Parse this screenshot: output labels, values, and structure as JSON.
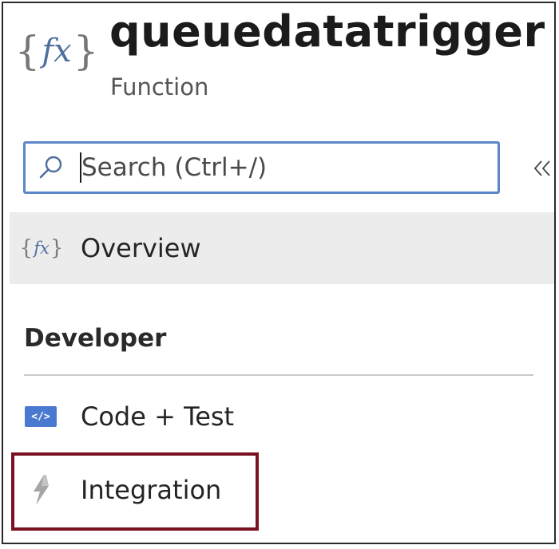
{
  "header": {
    "icon": "function-fx-icon",
    "title": "queuedatatrigger",
    "subtitle": "Function"
  },
  "search": {
    "placeholder": "Search (Ctrl+/)",
    "value": "",
    "icon": "search-icon",
    "focus_color": "#5b86c9"
  },
  "collapse": {
    "label": "«",
    "icon": "double-chevron-left-icon"
  },
  "nav": {
    "overview": {
      "label": "Overview",
      "icon": "function-fx-icon",
      "selected": true,
      "background": "#ececec"
    },
    "section": {
      "title": "Developer"
    },
    "items": [
      {
        "label": "Code + Test",
        "icon": "code-icon",
        "icon_color": "#4a7ad0"
      },
      {
        "label": "Integration",
        "icon": "lightning-bolt-icon",
        "icon_color": "#9a9a9a"
      }
    ]
  },
  "highlight": {
    "color": "#7a1020",
    "target": "Integration"
  }
}
